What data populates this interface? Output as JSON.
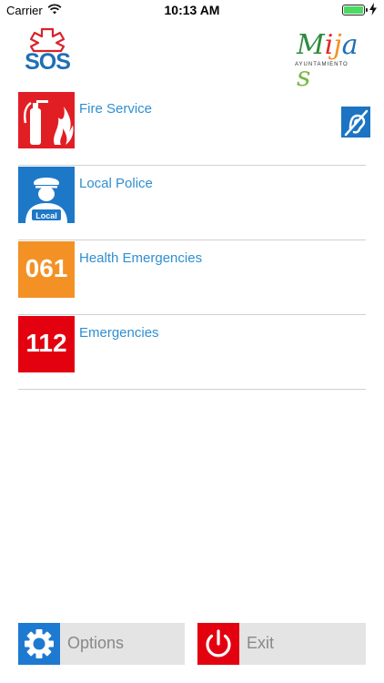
{
  "status_bar": {
    "carrier": "Carrier",
    "time": "10:13 AM"
  },
  "header": {
    "sos_logo_text": "SOS",
    "mijas_logo_text": [
      "M",
      "i",
      "j",
      "a",
      "s"
    ],
    "mijas_subtitle": "AYUNTAMIENTO"
  },
  "services": [
    {
      "label": "Fire Service"
    },
    {
      "label": "Local Police",
      "badge": "Local"
    },
    {
      "label": "Health Emergencies",
      "number": "061"
    },
    {
      "label": "Emergencies",
      "number": "112"
    }
  ],
  "bottom": {
    "options_label": "Options",
    "exit_label": "Exit"
  },
  "colors": {
    "link_blue": "#2f8fd0",
    "fire_red": "#e21e25",
    "police_blue": "#1e78c8",
    "health_orange": "#f39125",
    "emergency_red": "#e3000f",
    "battery_green": "#4cd964",
    "button_bg": "#e4e4e4"
  },
  "icons": {
    "fire": "fire-extinguisher-icon",
    "police": "police-officer-icon",
    "hearing": "hearing-loop-icon",
    "options": "gear-icon",
    "exit": "power-icon"
  }
}
